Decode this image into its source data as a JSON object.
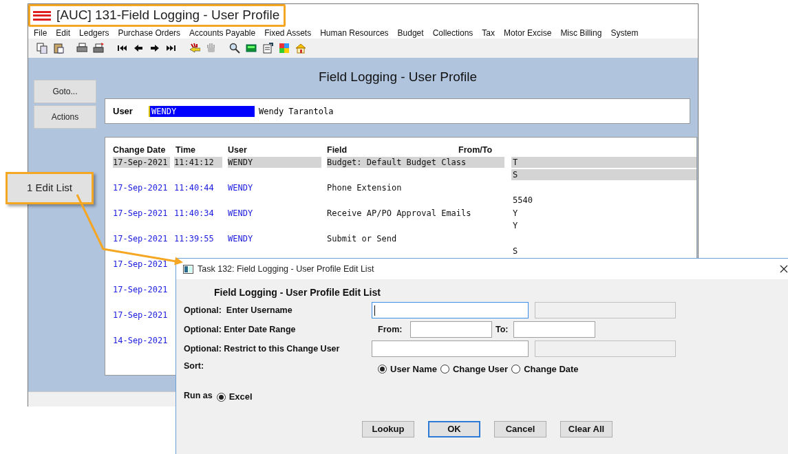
{
  "window": {
    "title": "[AUC] 131-Field Logging - User Profile"
  },
  "menu": [
    "File",
    "Edit",
    "Ledgers",
    "Purchase Orders",
    "Accounts Payable",
    "Fixed Assets",
    "Human Resources",
    "Budget",
    "Collections",
    "Tax",
    "Motor Excise",
    "Misc Billing",
    "System"
  ],
  "page_title": "Field Logging - User Profile",
  "side_buttons": [
    "Goto...",
    "Actions"
  ],
  "user_panel": {
    "label": "User",
    "value": "WENDY",
    "full_name": "Wendy Tarantola"
  },
  "table": {
    "columns": [
      "Change Date",
      "Time",
      "User",
      "Field",
      "From/To"
    ],
    "rows": [
      {
        "date": "17-Sep-2021",
        "time": "11:41:12",
        "user": "WENDY",
        "field": "Budget: Default Budget Class",
        "from": "T",
        "to": "S",
        "selected": true
      },
      {
        "date": "17-Sep-2021",
        "time": "11:40:44",
        "user": "WENDY",
        "field": "Phone Extension",
        "to": "5540",
        "selected": false
      },
      {
        "date": "17-Sep-2021",
        "time": "11:40:34",
        "user": "WENDY",
        "field": "Receive AP/PO Approval Emails",
        "from": "Y",
        "to": "Y",
        "selected": false
      },
      {
        "date": "17-Sep-2021",
        "time": "11:39:55",
        "user": "WENDY",
        "field": "Submit or Send",
        "to": "S",
        "selected": false
      },
      {
        "date": "17-Sep-2021",
        "selected": false
      },
      {
        "date": "17-Sep-2021",
        "selected": false
      },
      {
        "date": "17-Sep-2021",
        "selected": false
      },
      {
        "date": "14-Sep-2021",
        "selected": false
      }
    ]
  },
  "callout": {
    "label": "1 Edit List"
  },
  "dialog": {
    "title": "Task 132: Field Logging - User Profile Edit List",
    "heading": "Field Logging - User Profile Edit List",
    "fields": [
      {
        "kind": "user",
        "label": "Optional:  Enter Username",
        "focused": true
      },
      {
        "kind": "date_range",
        "label": "Optional: Enter Date Range",
        "from_label": "From:",
        "to_label": "To:"
      },
      {
        "kind": "user",
        "label": "Optional: Restrict to this Change User",
        "focused": false
      }
    ],
    "sort": {
      "label": "Sort:",
      "options": [
        {
          "label": "User Name",
          "selected": true
        },
        {
          "label": "Change User",
          "selected": false
        },
        {
          "label": "Change Date",
          "selected": false
        }
      ]
    },
    "run_as": {
      "label": "Run as",
      "options": [
        {
          "label": "Excel",
          "selected": true
        }
      ]
    },
    "buttons": [
      {
        "label": "Lookup",
        "focused": false
      },
      {
        "label": "OK",
        "focused": true
      },
      {
        "label": "Cancel",
        "focused": false
      },
      {
        "label": "Clear All",
        "focused": false
      }
    ]
  }
}
